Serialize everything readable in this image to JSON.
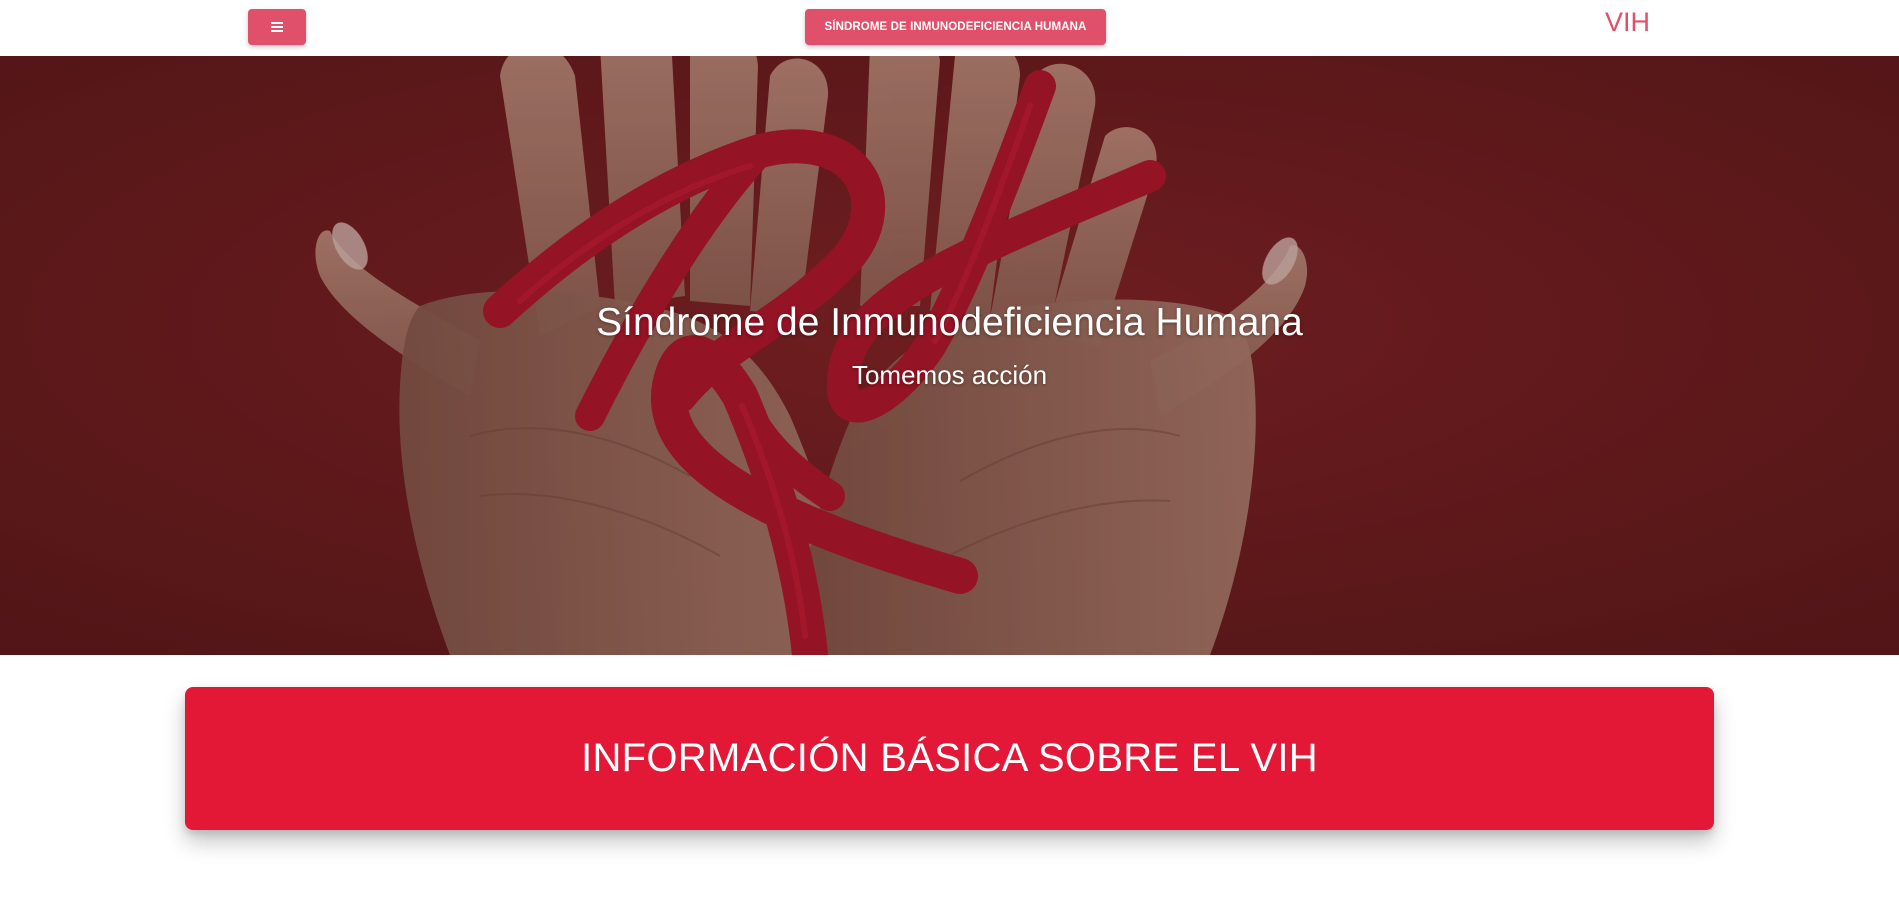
{
  "navbar": {
    "menu_icon": "hamburger-icon",
    "title_button_label": "SÍNDROME DE INMUNODEFICIENCIA HUMANA",
    "brand": "VIH"
  },
  "hero": {
    "title": "Síndrome de Inmunodeficiencia Humana",
    "subtitle": "Tomemos acción",
    "image_description_icon": "hands-red-ribbons-image"
  },
  "info_banner": {
    "heading": "INFORMACIÓN BÁSICA SOBRE EL VIH"
  },
  "colors": {
    "accent": "#e0506a",
    "banner_red": "#e31836",
    "hero_background": "#6a1f20",
    "ribbon_red": "#b01a28"
  }
}
